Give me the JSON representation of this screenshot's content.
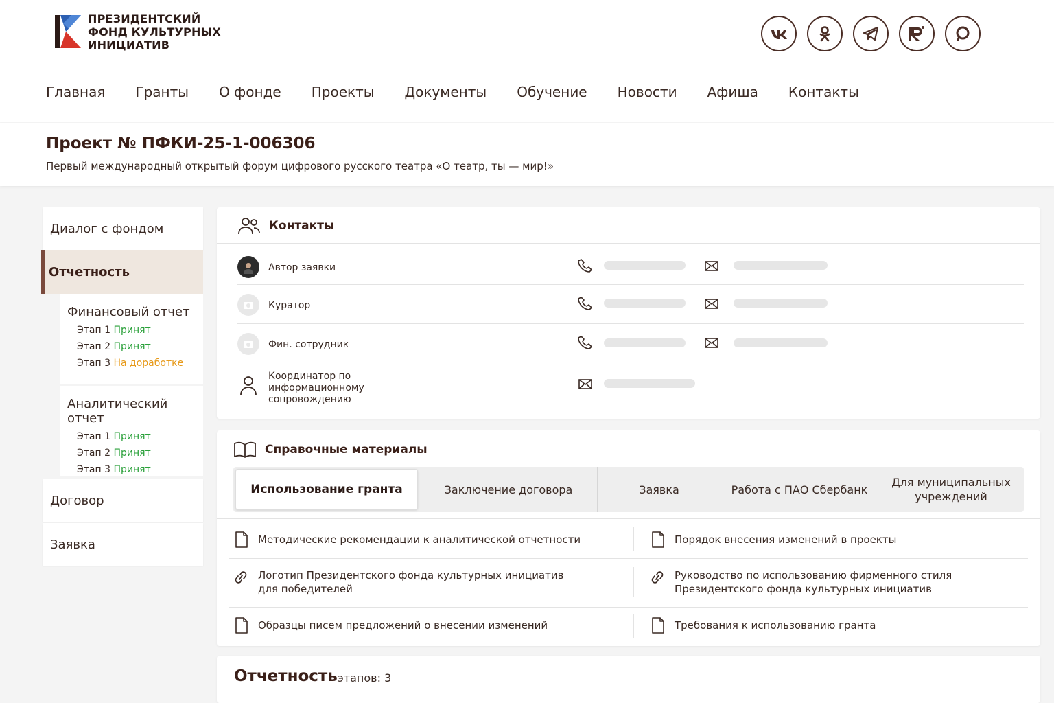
{
  "header": {
    "logo_lines": [
      "ПРЕЗИДЕНТСКИЙ",
      "ФОНД КУЛЬТУРНЫХ",
      "ИНИЦИАТИВ"
    ],
    "socials": [
      {
        "name": "vk-icon",
        "label": "VK"
      },
      {
        "name": "odnoklassniki-icon",
        "label": ""
      },
      {
        "name": "telegram-icon",
        "label": ""
      },
      {
        "name": "rutube-icon",
        "label": "R"
      },
      {
        "name": "max-icon",
        "label": ""
      }
    ],
    "nav": [
      "Главная",
      "Гранты",
      "О фонде",
      "Проекты",
      "Документы",
      "Обучение",
      "Новости",
      "Афиша",
      "Контакты"
    ]
  },
  "project": {
    "title": "Проект № ПФКИ-25-1-006306",
    "subtitle": "Первый международный открытый форум цифрового русского театра «О театр, ты — мир!»"
  },
  "sidebar": {
    "dialog": "Диалог с фондом",
    "reporting": "Отчетность",
    "financial": {
      "title": "Финансовый отчет",
      "stages": [
        {
          "label": "Этап 1",
          "status": "Принят"
        },
        {
          "label": "Этап 2",
          "status": "Принят"
        },
        {
          "label": "Этап 3",
          "status": "На доработке"
        }
      ]
    },
    "analytical": {
      "title": "Аналитический отчет",
      "stages": [
        {
          "label": "Этап 1",
          "status": "Принят"
        },
        {
          "label": "Этап 2",
          "status": "Принят"
        },
        {
          "label": "Этап 3",
          "status": "Принят"
        }
      ]
    },
    "contract": "Договор",
    "application": "Заявка"
  },
  "contacts": {
    "title": "Контакты",
    "rows": [
      "Автор заявки",
      "Куратор",
      "Фин. сотрудник"
    ],
    "coordinator": [
      "Координатор по",
      "информационному",
      "сопровождению"
    ]
  },
  "materials": {
    "title": "Справочные материалы",
    "tabs": [
      "Использование гранта",
      "Заключение договора",
      "Заявка",
      "Работа с ПАО Сбербанк",
      "Для муниципальных учреждений"
    ],
    "docs": {
      "left": [
        [
          "Методические рекомендации к аналитической отчетности"
        ],
        [
          "Логотип Президентского фонда культурных инициатив",
          "для победителей"
        ],
        [
          "Образцы писем предложений о внесении изменений"
        ]
      ],
      "right": [
        [
          "Порядок внесения изменений в проекты"
        ],
        [
          "Руководство по использованию фирменного стиля",
          "Президентского фонда культурных инициатив"
        ],
        [
          "Требования к использованию гранта"
        ]
      ]
    }
  },
  "report": {
    "title": "Отчетность",
    "count": "этапов: 3"
  }
}
